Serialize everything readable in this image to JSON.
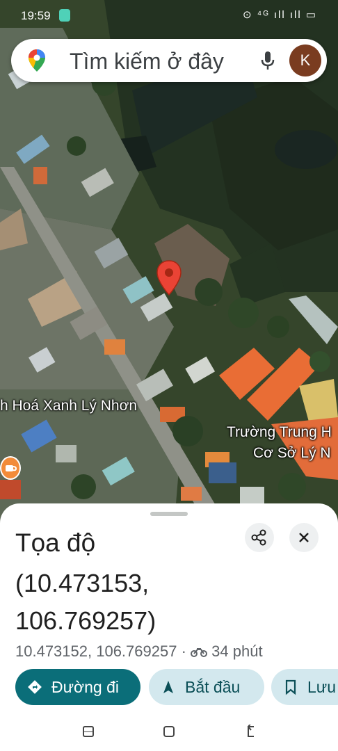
{
  "status_bar": {
    "time": "19:59",
    "right_icons": "⊙ ⁴ᴳ ıll ıll ▭"
  },
  "search": {
    "placeholder": "Tìm kiếm ở đây",
    "avatar_letter": "K",
    "pin_icon": "maps-pin-icon",
    "mic_icon": "microphone-icon"
  },
  "map": {
    "labels": {
      "park": "h Hoá Xanh Lý Nhơn",
      "school_line1": "Trường Trung H",
      "school_line2": "Cơ Sở Lý N"
    },
    "marker_icon": "red-location-pin-icon",
    "poi_icon": "coffee-cup-icon"
  },
  "sheet": {
    "title": "Tọa độ",
    "coords_line1": "(10.473153,",
    "coords_line2": "106.769257)",
    "coordinates_text": "10.473152, 106.769257",
    "separator": "·",
    "travel_time": "34 phút",
    "travel_mode_icon": "motorbike-icon",
    "share_icon": "share-icon",
    "close_icon": "close-icon"
  },
  "actions": {
    "directions": "Đường đi",
    "start": "Bắt đầu",
    "save": "Lưu"
  },
  "colors": {
    "primary": "#0b6e79",
    "tonal": "#d3e8ee",
    "marker": "#ea4335"
  }
}
